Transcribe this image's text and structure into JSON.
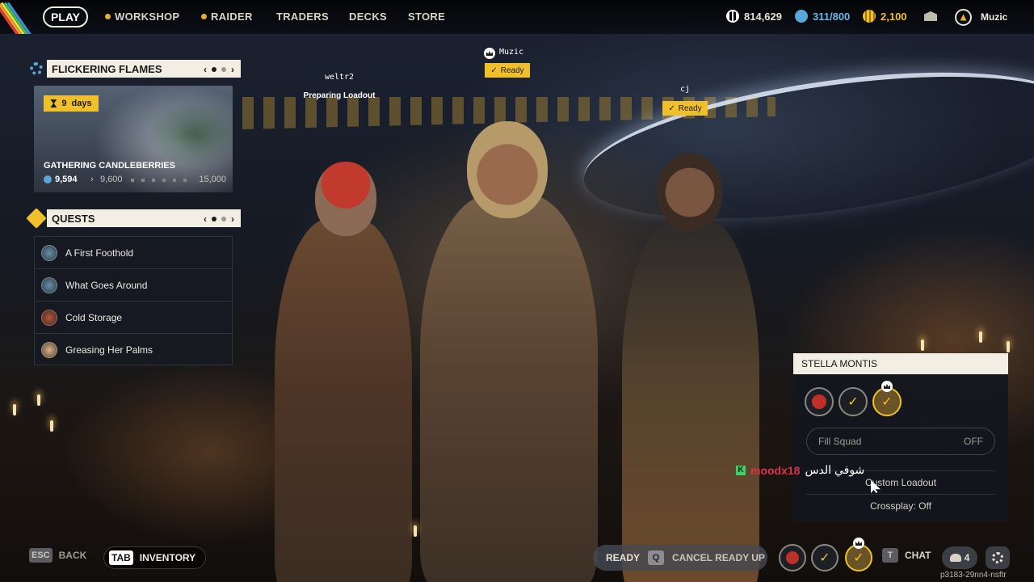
{
  "topbar": {
    "play": "PLAY",
    "nav": [
      {
        "label": "WORKSHOP",
        "dot": true
      },
      {
        "label": "RAIDER",
        "dot": true
      },
      {
        "label": "TRADERS",
        "dot": false
      },
      {
        "label": "DECKS",
        "dot": false
      },
      {
        "label": "STORE",
        "dot": false
      }
    ],
    "currencies": [
      {
        "icon": "coin-icon",
        "value": "814,629",
        "color": "#ffffff"
      },
      {
        "icon": "raider-token-icon",
        "value": "311/800",
        "color": "#6bb6e8"
      },
      {
        "icon": "gold-icon",
        "value": "2,100",
        "color": "#f0c02a"
      }
    ],
    "profile_name": "Muzic"
  },
  "event": {
    "title": "FLICKERING FLAMES",
    "days_left": "9",
    "days_label": "days",
    "name": "GATHERING CANDLEBERRIES",
    "current": "9,594",
    "next": "9,600",
    "max": "15,000"
  },
  "quests": {
    "title": "QUESTS",
    "items": [
      "A First Foothold",
      "What Goes Around",
      "Cold Storage",
      "Greasing Her Palms"
    ]
  },
  "players": {
    "left": {
      "name": "weltr2",
      "status": "Preparing Loadout"
    },
    "mid": {
      "name": "Muzic",
      "status": "Ready"
    },
    "right": {
      "name": "cj",
      "status": "Ready"
    }
  },
  "squad": {
    "title": "STELLA MONTIS",
    "fill_label": "Fill Squad",
    "fill_value": "OFF",
    "option1": "Custom Loadout",
    "option2": "Crossplay: Off"
  },
  "chat": {
    "badge": "K",
    "user": "moodx18",
    "message": "شوفي الدس"
  },
  "bottom": {
    "esc_key": "ESC",
    "back": "BACK",
    "tab_key": "TAB",
    "inventory": "INVENTORY",
    "ready": "READY",
    "q_key": "Q",
    "cancel": "CANCEL READY UP",
    "t_key": "T",
    "chat": "CHAT",
    "party_count": "4",
    "build_id": "p3183-29nn4-nsftr"
  },
  "colors": {
    "accent_yellow": "#f0c02a",
    "panel_header": "#f2eee4",
    "blue": "#58a7d8",
    "chat_red": "#e0314a"
  }
}
